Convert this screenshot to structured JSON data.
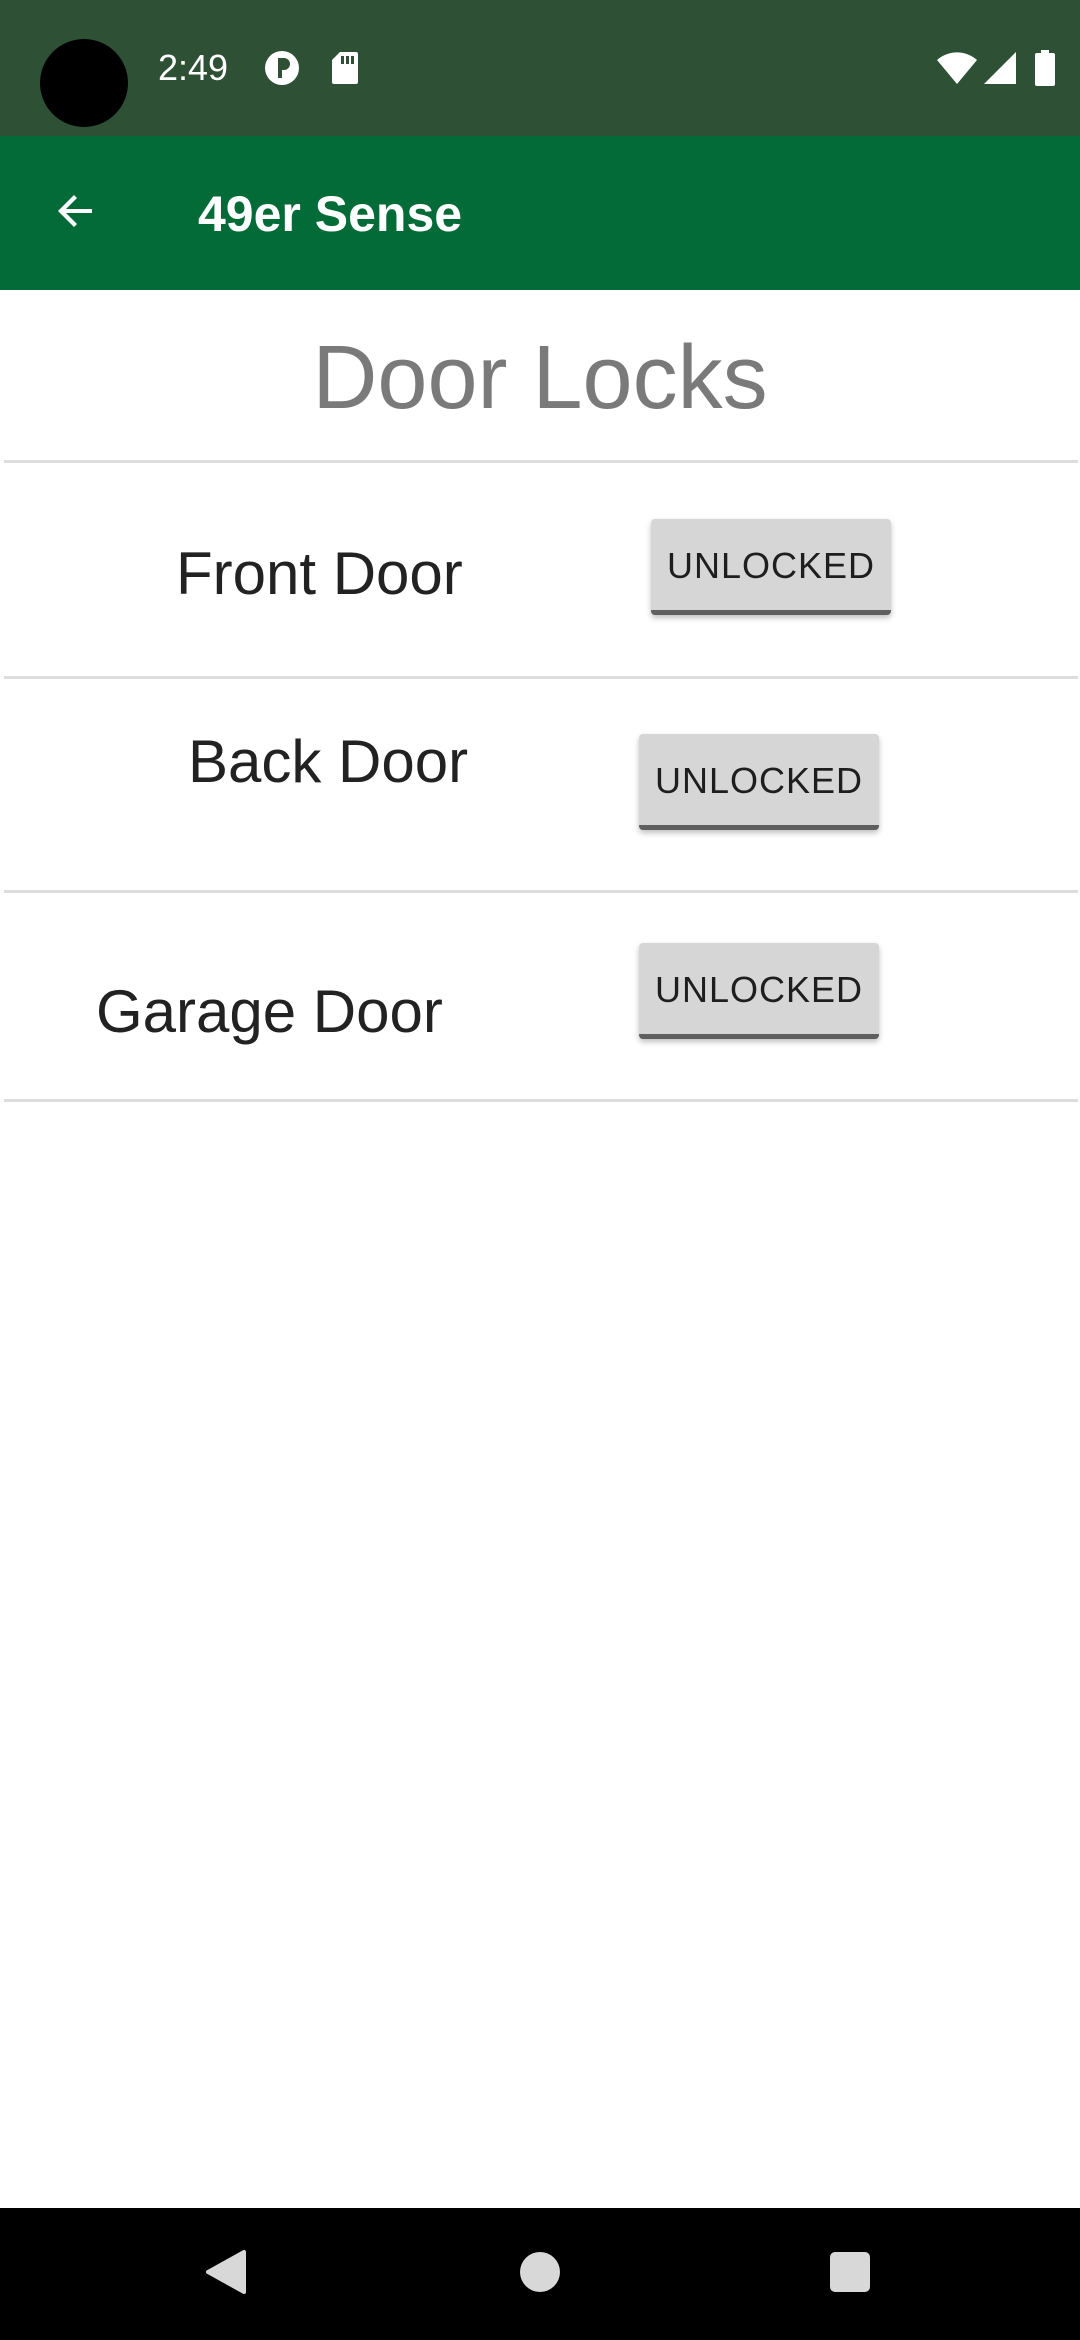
{
  "status_bar": {
    "time": "2:49",
    "icons": [
      "notification-app-icon",
      "sd-card-icon",
      "wifi-icon",
      "cell-signal-icon",
      "battery-icon"
    ]
  },
  "app_bar": {
    "title": "49er Sense",
    "back_icon": "arrow-left-icon"
  },
  "page": {
    "title": "Door Locks",
    "locks": [
      {
        "name": "Front Door",
        "status": "UNLOCKED"
      },
      {
        "name": "Back Door",
        "status": "UNLOCKED"
      },
      {
        "name": "Garage Door",
        "status": "UNLOCKED"
      }
    ]
  },
  "nav_bar": {
    "icons": [
      "back-triangle-icon",
      "home-circle-icon",
      "recents-square-icon"
    ]
  },
  "colors": {
    "status_bar": "#2e5135",
    "app_bar": "#036b37",
    "button_bg": "#d6d6d6",
    "title_text": "#7a7a7a"
  }
}
